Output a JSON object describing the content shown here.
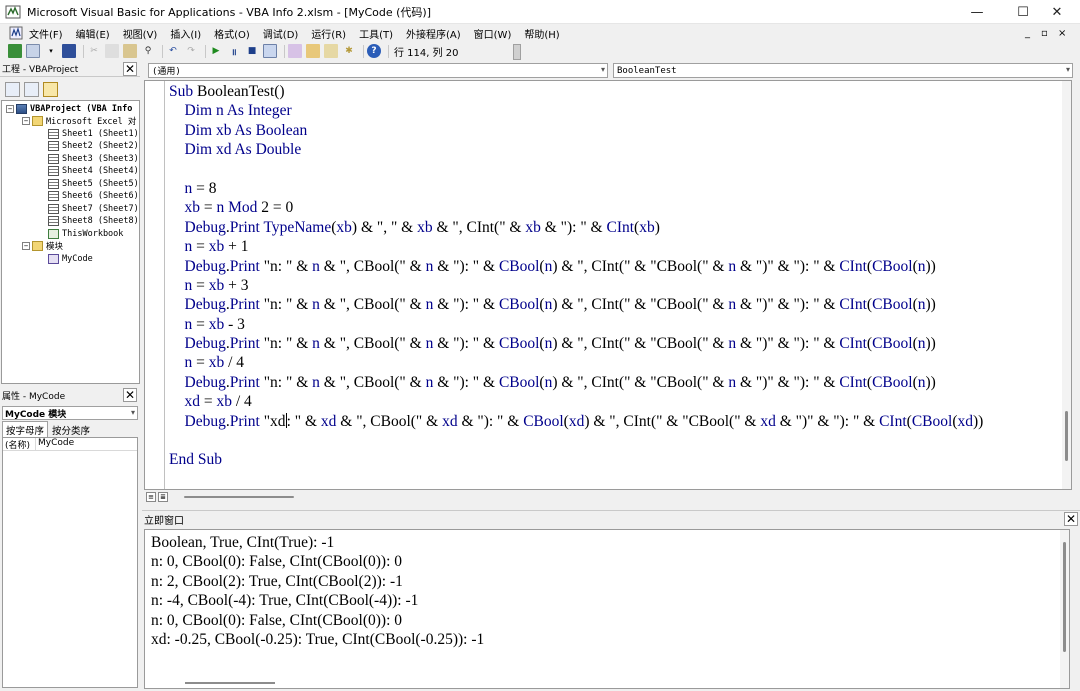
{
  "window": {
    "title": "Microsoft Visual Basic for Applications - VBA Info 2.xlsm - [MyCode (代码)]",
    "min": "—",
    "max": "☐",
    "close": "✕"
  },
  "menu": {
    "items": [
      "文件(F)",
      "编辑(E)",
      "视图(V)",
      "插入(I)",
      "格式(O)",
      "调试(D)",
      "运行(R)",
      "工具(T)",
      "外接程序(A)",
      "窗口(W)",
      "帮助(H)"
    ],
    "mdi_min": "_",
    "mdi_restore": "▫",
    "mdi_close": "×"
  },
  "toolbar": {
    "position": "行 114, 列 20"
  },
  "project": {
    "title": "工程 - VBAProject",
    "tree": {
      "root": "VBAProject (VBA Info",
      "excel_objects": "Microsoft Excel 对",
      "sheets": [
        "Sheet1 (Sheet1)",
        "Sheet2 (Sheet2)",
        "Sheet3 (Sheet3)",
        "Sheet4 (Sheet4)",
        "Sheet5 (Sheet5)",
        "Sheet6 (Sheet6)",
        "Sheet7 (Sheet7)",
        "Sheet8 (Sheet8)"
      ],
      "workbook": "ThisWorkbook",
      "modules": "模块",
      "module": "MyCode"
    }
  },
  "properties": {
    "title": "属性 - MyCode",
    "object": "MyCode 模块",
    "tab_alpha": "按字母序",
    "tab_cat": "按分类序",
    "row_key": "(名称)",
    "row_value": "MyCode"
  },
  "code": {
    "object_combo": "(通用)",
    "proc_combo": "BooleanTest",
    "lines": [
      "Sub BooleanTest()",
      "    Dim n As Integer",
      "    Dim xb As Boolean",
      "    Dim xd As Double",
      "",
      "    n = 8",
      "    xb = n Mod 2 = 0",
      "    Debug.Print TypeName(xb) & \", \" & xb & \", CInt(\" & xb & \"): \" & CInt(xb)",
      "    n = xb + 1",
      "    Debug.Print \"n: \" & n & \", CBool(\" & n & \"): \" & CBool(n) & \", CInt(\" & \"CBool(\" & n & \")\" & \"): \" & CInt(CBool(n))",
      "    n = xb + 3",
      "    Debug.Print \"n: \" & n & \", CBool(\" & n & \"): \" & CBool(n) & \", CInt(\" & \"CBool(\" & n & \")\" & \"): \" & CInt(CBool(n))",
      "    n = xb - 3",
      "    Debug.Print \"n: \" & n & \", CBool(\" & n & \"): \" & CBool(n) & \", CInt(\" & \"CBool(\" & n & \")\" & \"): \" & CInt(CBool(n))",
      "    n = xb / 4",
      "    Debug.Print \"n: \" & n & \", CBool(\" & n & \"): \" & CBool(n) & \", CInt(\" & \"CBool(\" & n & \")\" & \"): \" & CInt(CBool(n))",
      "    xd = xb / 4",
      "    Debug.Print \"xd: \" & xd & \", CBool(\" & xd & \"): \" & CBool(xd) & \", CInt(\" & \"CBool(\" & xd & \")\" & \"): \" & CInt(CBool(xd))",
      "",
      "End Sub"
    ]
  },
  "immediate": {
    "title": "立即窗口",
    "lines": [
      "Boolean, True, CInt(True): -1",
      "n: 0, CBool(0): False, CInt(CBool(0)): 0",
      "n: 2, CBool(2): True, CInt(CBool(2)): -1",
      "n: -4, CBool(-4): True, CInt(CBool(-4)): -1",
      "n: 0, CBool(0): False, CInt(CBool(0)): 0",
      "xd: -0.25, CBool(-0.25): True, CInt(CBool(-0.25)): -1"
    ]
  }
}
